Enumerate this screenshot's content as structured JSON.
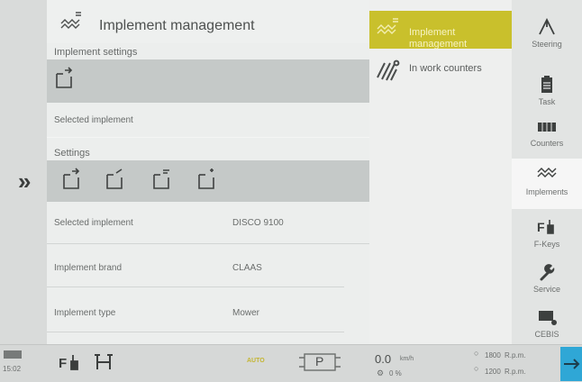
{
  "header": {
    "title": "Implement management"
  },
  "sections": {
    "implement_settings": "Implement settings",
    "selected_implement": "Selected implement",
    "settings": "Settings"
  },
  "details": [
    {
      "label": "Selected implement",
      "value": "DISCO 9100"
    },
    {
      "label": "Implement brand",
      "value": "CLAAS"
    },
    {
      "label": "Implement type",
      "value": "Mower"
    }
  ],
  "submenu": [
    {
      "label": "Implement management",
      "icon": "implement-management-icon",
      "active": true
    },
    {
      "label": "In work counters",
      "icon": "in-work-counters-icon",
      "active": false
    }
  ],
  "nav": [
    {
      "label": "Steering",
      "icon": "steering-icon"
    },
    {
      "label": "Task",
      "icon": "task-icon"
    },
    {
      "label": "Counters",
      "icon": "counters-icon"
    },
    {
      "label": "Implements",
      "icon": "implements-icon"
    },
    {
      "label": "F-Keys",
      "icon": "f-keys-icon"
    },
    {
      "label": "Service",
      "icon": "service-icon"
    },
    {
      "label": "CEBIS",
      "icon": "cebis-icon"
    }
  ],
  "status": {
    "time": "15:02",
    "auto": "AUTO",
    "gear": "P",
    "speed": "0.0",
    "speed_unit": "km/h",
    "slip": "0 %",
    "rpm1": "1800",
    "rpm2": "1200",
    "rpm_unit": "R.p.m."
  },
  "colors": {
    "accent": "#c9c02c",
    "bar": "#c5c9c8"
  }
}
